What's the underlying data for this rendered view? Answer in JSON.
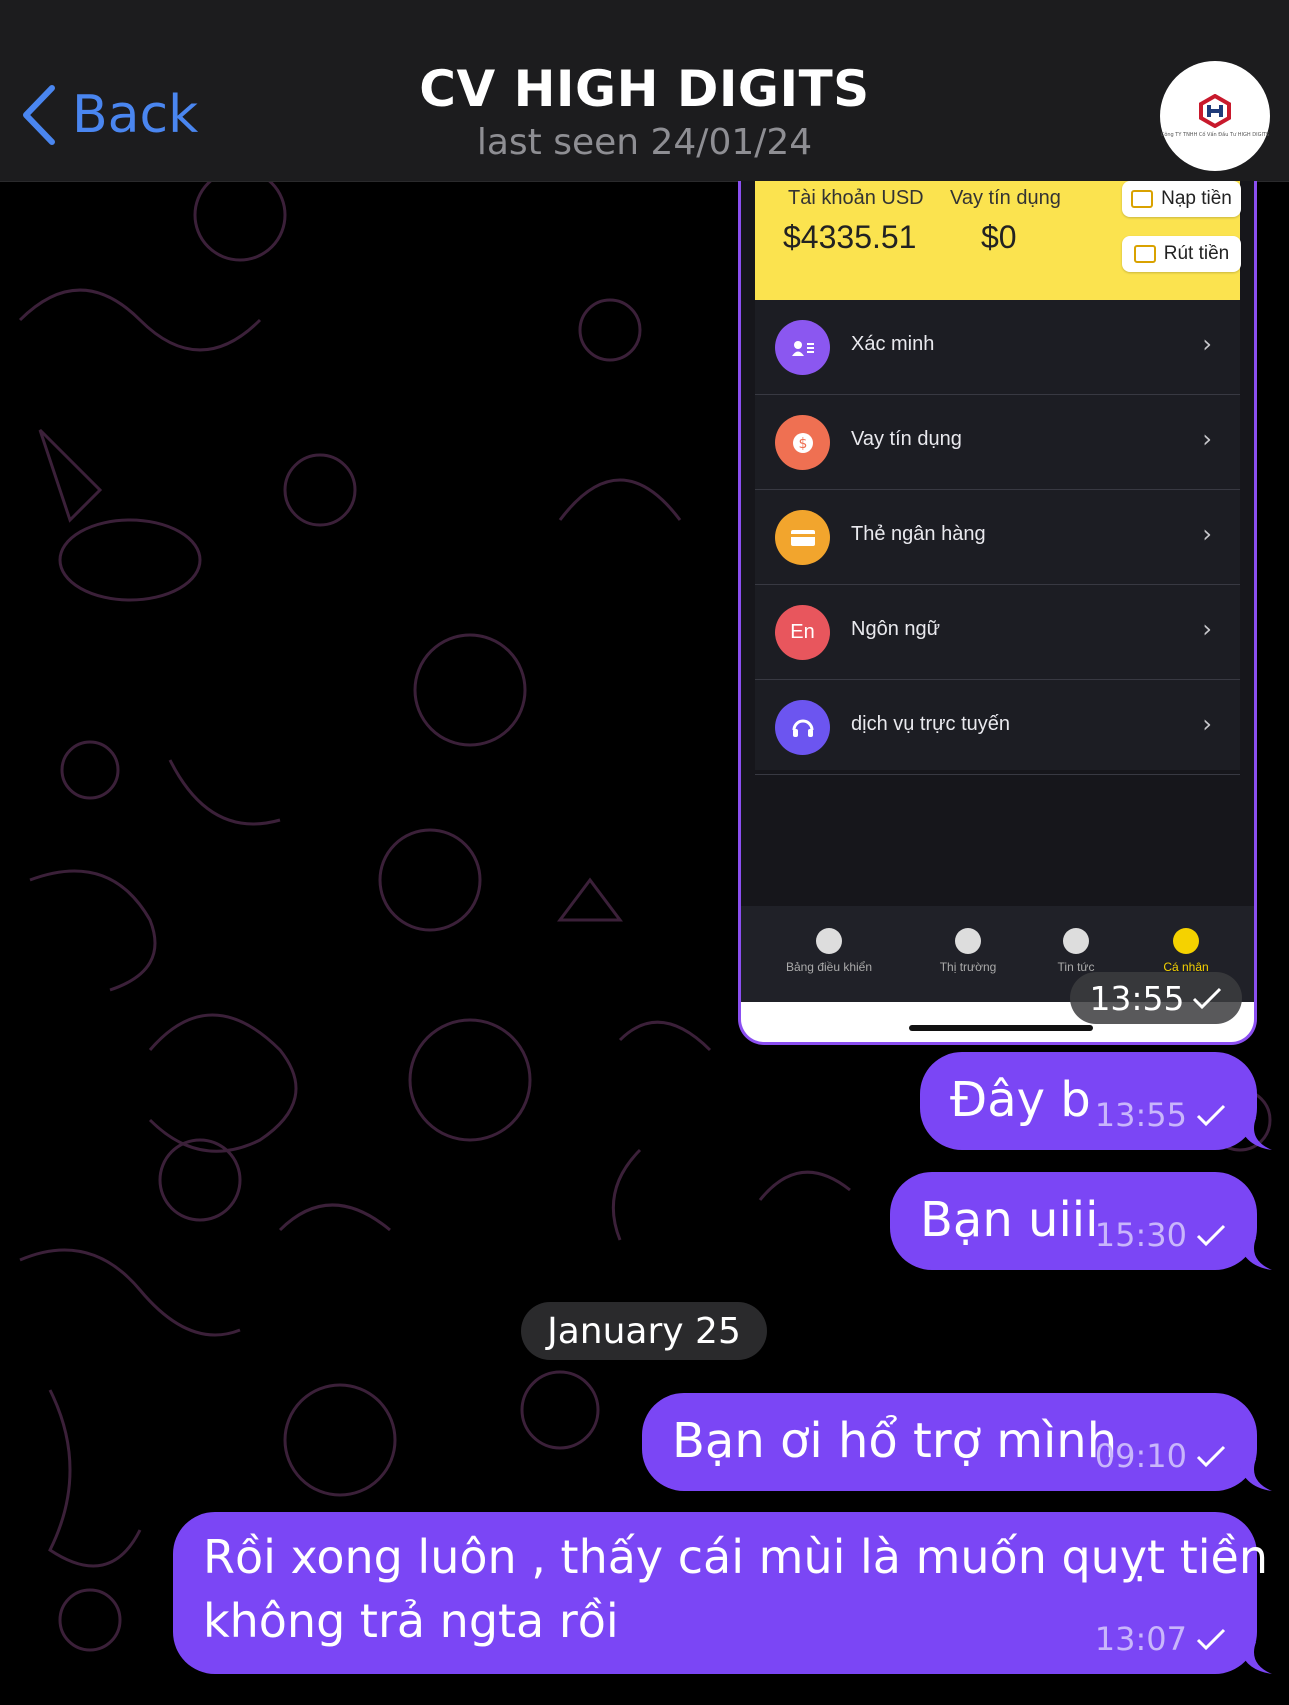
{
  "header": {
    "back_label": "Back",
    "title": "CV HIGH DIGITS",
    "subtitle": "last seen 24/01/24",
    "avatar_caption": "Công TY TNHH Cố Vấn Đầu Tư HIGH DIGITS"
  },
  "image_message": {
    "time": "13:55",
    "screenshot": {
      "account_label": "Tài khoản USD",
      "account_value": "$4335.51",
      "loan_label": "Vay tín dụng",
      "loan_value": "$0",
      "deposit_button": "Nạp tiền",
      "withdraw_button": "Rút tiền",
      "menu": [
        {
          "label": "Xác minh",
          "icon": "id-card-icon",
          "color": "#8b57f0"
        },
        {
          "label": "Vay tín dụng",
          "icon": "coin-icon",
          "color": "#ef7052"
        },
        {
          "label": "Thẻ ngân hàng",
          "icon": "card-icon",
          "color": "#f2a52d"
        },
        {
          "label": "Ngôn ngữ",
          "icon": "En",
          "color": "#e8565d"
        },
        {
          "label": "dịch vụ trực tuyến",
          "icon": "headset-icon",
          "color": "#6c55f0"
        }
      ],
      "tabs": [
        {
          "label": "Bảng điều khiển",
          "icon": "home-icon"
        },
        {
          "label": "Thị trường",
          "icon": "market-icon"
        },
        {
          "label": "Tin tức",
          "icon": "compass-icon"
        },
        {
          "label": "Cá nhân",
          "icon": "person-icon"
        }
      ]
    }
  },
  "messages": [
    {
      "text": "Đây b",
      "time": "13:55"
    },
    {
      "text": "Bạn uiii",
      "time": "15:30"
    },
    {
      "text": "Bạn ơi hổ trợ mình",
      "time": "09:10"
    },
    {
      "line1": "Rồi xong luôn , thấy cái mùi là muốn quỵt tiền",
      "line2": "không trả ngta rồi",
      "time": "13:07"
    }
  ],
  "date_separator": "January 25",
  "colors": {
    "bubble": "#7b46f5",
    "header_bg": "#1c1c1e",
    "back_blue": "#4a86f0",
    "doodle": "#3a1f3d"
  }
}
